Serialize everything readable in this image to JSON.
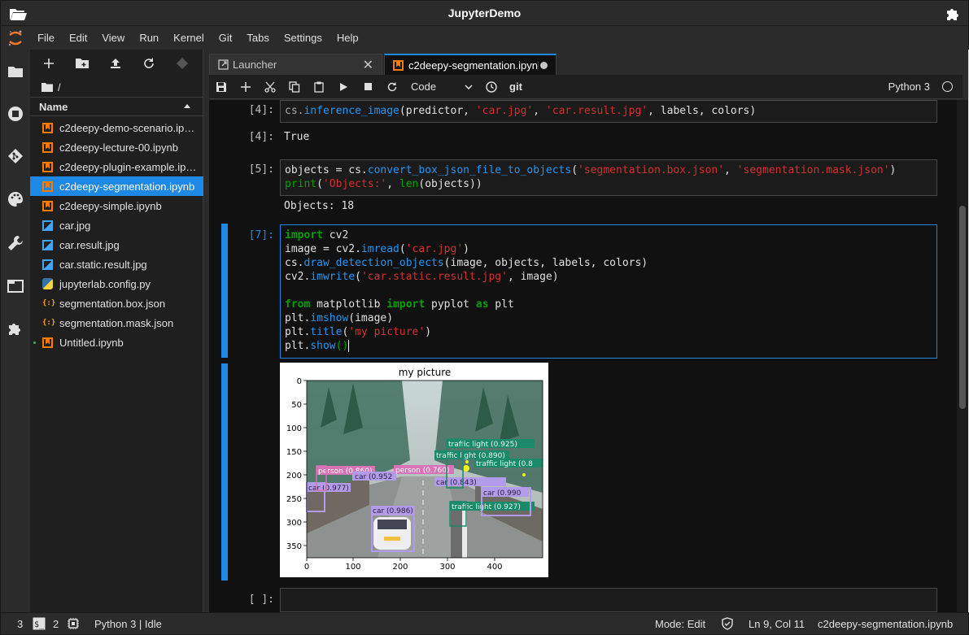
{
  "window": {
    "title": "JupyterDemo"
  },
  "menu": [
    "File",
    "Edit",
    "View",
    "Run",
    "Kernel",
    "Git",
    "Tabs",
    "Settings",
    "Help"
  ],
  "filebrowser": {
    "path": "/",
    "column_header": "Name",
    "files": [
      {
        "name": "c2deepy-demo-scenario.ipynb",
        "type": "notebook",
        "selected": false,
        "running": false
      },
      {
        "name": "c2deepy-lecture-00.ipynb",
        "type": "notebook",
        "selected": false,
        "running": false
      },
      {
        "name": "c2deepy-plugin-example.ipynb",
        "type": "notebook",
        "selected": false,
        "running": false
      },
      {
        "name": "c2deepy-segmentation.ipynb",
        "type": "notebook",
        "selected": true,
        "running": false
      },
      {
        "name": "c2deepy-simple.ipynb",
        "type": "notebook",
        "selected": false,
        "running": false
      },
      {
        "name": "car.jpg",
        "type": "image",
        "selected": false,
        "running": false
      },
      {
        "name": "car.result.jpg",
        "type": "image",
        "selected": false,
        "running": false
      },
      {
        "name": "car.static.result.jpg",
        "type": "image",
        "selected": false,
        "running": false
      },
      {
        "name": "jupyterlab.config.py",
        "type": "python",
        "selected": false,
        "running": false
      },
      {
        "name": "segmentation.box.json",
        "type": "json",
        "selected": false,
        "running": false
      },
      {
        "name": "segmentation.mask.json",
        "type": "json",
        "selected": false,
        "running": false
      },
      {
        "name": "Untitled.ipynb",
        "type": "notebook",
        "selected": false,
        "running": true
      }
    ]
  },
  "tabs": [
    {
      "label": "Launcher",
      "active": false
    },
    {
      "label": "c2deepy-segmentation.ipynb",
      "active": true
    }
  ],
  "notebook_toolbar": {
    "cell_type": "Code",
    "kernel": "Python 3"
  },
  "cells": {
    "c4": {
      "prompt": "[4]:",
      "code": "cs.inference_image(predictor, 'car.jpg', 'car.result.jpg', labels, colors)",
      "out_prompt": "[4]:",
      "output": "True"
    },
    "c5": {
      "prompt": "[5]:",
      "code_line1": "objects = cs.convert_box_json_file_to_objects('segmentation.box.json', 'segmentation.mask.json')",
      "code_line2": "print('Objects:', len(objects))",
      "output": "Objects: 18"
    },
    "c7": {
      "prompt": "[7]:"
    },
    "empty": {
      "prompt": "[ ]:"
    }
  },
  "figure": {
    "title": "my picture",
    "x_ticks": [
      "0",
      "100",
      "200",
      "300",
      "400"
    ],
    "y_ticks": [
      "0",
      "50",
      "100",
      "150",
      "200",
      "250",
      "300",
      "350"
    ],
    "labels": [
      "traffic light (0.925)",
      "traffic light (0.890)",
      "traffic light (0.8",
      "person (0.860)",
      "person (0.760)",
      "car (0.952",
      "car (0.977)",
      "car (0.843)",
      "car (0.990",
      "car (0.986)",
      "traffic light (0.927)"
    ]
  },
  "statusbar": {
    "terminals": "3",
    "kernels": "2",
    "kernel_status": "Python 3 | Idle",
    "mode": "Mode: Edit",
    "position": "Ln 9, Col 11",
    "file": "c2deepy-segmentation.ipynb"
  }
}
